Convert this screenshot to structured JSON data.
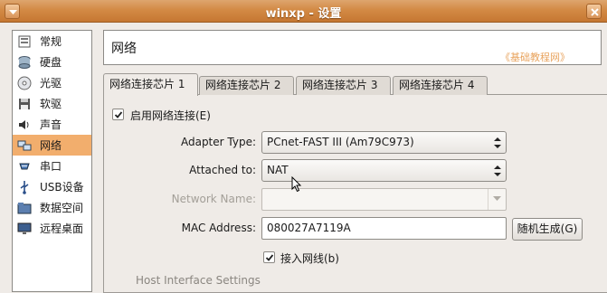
{
  "window": {
    "title": "winxp - 设置"
  },
  "sidebar": {
    "items": [
      {
        "label": "常规",
        "icon": "general-icon"
      },
      {
        "label": "硬盘",
        "icon": "harddisk-icon"
      },
      {
        "label": "光驱",
        "icon": "cdrom-icon"
      },
      {
        "label": "软驱",
        "icon": "floppy-icon"
      },
      {
        "label": "声音",
        "icon": "sound-icon"
      },
      {
        "label": "网络",
        "icon": "network-icon",
        "selected": true
      },
      {
        "label": "串口",
        "icon": "serial-port-icon"
      },
      {
        "label": "USB设备",
        "icon": "usb-icon"
      },
      {
        "label": "数据空间",
        "icon": "shared-folder-icon"
      },
      {
        "label": "远程桌面",
        "icon": "remote-desktop-icon"
      }
    ]
  },
  "header": {
    "title": "网络",
    "watermark": "《基础教程网》"
  },
  "tabs": [
    {
      "label": "网络连接芯片 1",
      "active": true
    },
    {
      "label": "网络连接芯片 2",
      "active": false
    },
    {
      "label": "网络连接芯片 3",
      "active": false
    },
    {
      "label": "网络连接芯片 4",
      "active": false
    }
  ],
  "form": {
    "enable_label": "启用网络连接(E)",
    "enable_checked": true,
    "adapter_type_label": "Adapter Type:",
    "adapter_type_value": "PCnet-FAST III (Am79C973)",
    "attached_to_label": "Attached to:",
    "attached_to_value": "NAT",
    "network_name_label": "Network Name:",
    "network_name_value": "",
    "mac_label": "MAC Address:",
    "mac_value": "080027A7119A",
    "generate_button": "随机生成(G)",
    "cable_label": "接入网线(b)",
    "cable_checked": true,
    "host_interface_section": "Host Interface Settings"
  },
  "colors": {
    "titlebar": "#d38a45",
    "selection": "#f2ae6d",
    "watermark": "#e8a35d"
  }
}
